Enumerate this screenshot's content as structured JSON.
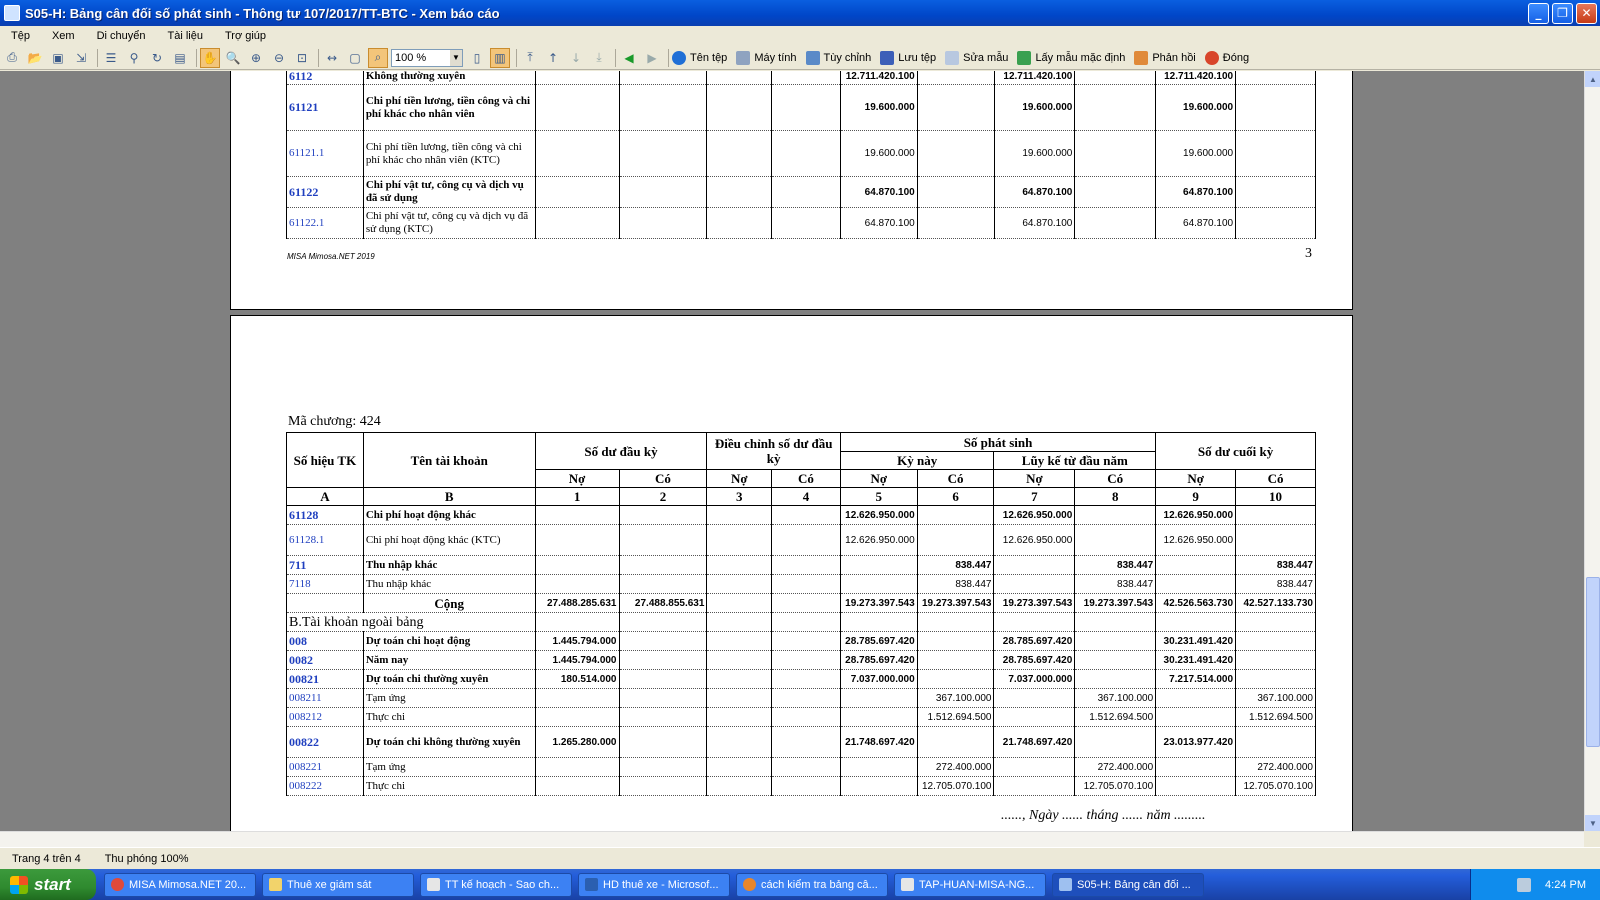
{
  "window": {
    "title": "S05-H: Bảng cân đối số phát sinh  - Thông tư 107/2017/TT-BTC - Xem báo cáo",
    "minimize": "_",
    "restore": "❐",
    "close": "✕"
  },
  "menu": [
    "Tệp",
    "Xem",
    "Di chuyển",
    "Tài liệu",
    "Trợ giúp"
  ],
  "toolbar": {
    "zoom": "100 %",
    "buttons": [
      "Tên tệp",
      "Máy tính",
      "Tùy chỉnh",
      "Lưu tệp",
      "Sửa mẫu",
      "Lấy mẫu mặc định",
      "Phản hồi",
      "Đóng"
    ]
  },
  "page3": {
    "rows": [
      {
        "code": "6112",
        "name": "Không thường xuyên",
        "bold": true,
        "c5": "12.711.420.100",
        "c7": "12.711.420.100",
        "c9": "12.711.420.100"
      },
      {
        "code": "61121",
        "name": "Chi phí tiền lương, tiền công và chi phí khác cho nhân viên",
        "bold": true,
        "c5": "19.600.000",
        "c7": "19.600.000",
        "c9": "19.600.000"
      },
      {
        "code": "61121.1",
        "name": "Chi phí tiền lương, tiền công và chi phí khác cho nhân viên (KTC)",
        "bold": false,
        "c5": "19.600.000",
        "c7": "19.600.000",
        "c9": "19.600.000"
      },
      {
        "code": "61122",
        "name": "Chi phí vật tư, công cụ và dịch vụ đã sử dụng",
        "bold": true,
        "c5": "64.870.100",
        "c7": "64.870.100",
        "c9": "64.870.100"
      },
      {
        "code": "61122.1",
        "name": "Chi phí vật tư, công cụ và dịch vụ đã sử dụng (KTC)",
        "bold": false,
        "c5": "64.870.100",
        "c7": "64.870.100",
        "c9": "64.870.100"
      }
    ],
    "footer_left": "MISA Mimosa.NET 2019",
    "page_number": "3"
  },
  "page4": {
    "chapter": "Mã chương: 424",
    "headers": {
      "code": "Số hiệu TK",
      "name": "Tên tài khoản",
      "opening": "Số dư đầu kỳ",
      "adjust": "Điều chỉnh số dư đầu kỳ",
      "arising": "Số phát sinh",
      "this_period": "Kỳ này",
      "ytd": "Lũy kế từ đầu năm",
      "closing": "Số dư cuối kỳ",
      "debit": "Nợ",
      "credit": "Có",
      "letters": [
        "A",
        "B",
        "1",
        "2",
        "3",
        "4",
        "5",
        "6",
        "7",
        "8",
        "9",
        "10"
      ]
    },
    "rows": [
      {
        "code": "61128",
        "name": "Chi phí hoạt động khác",
        "bold": true,
        "c5": "12.626.950.000",
        "c7": "12.626.950.000",
        "c9": "12.626.950.000"
      },
      {
        "code": "61128.1",
        "name": "Chi phí hoạt động khác (KTC)",
        "bold": false,
        "c5": "12.626.950.000",
        "c7": "12.626.950.000",
        "c9": "12.626.950.000"
      },
      {
        "code": "711",
        "name": "Thu nhập khác",
        "bold": true,
        "c6": "838.447",
        "c8": "838.447",
        "c10": "838.447"
      },
      {
        "code": "7118",
        "name": "Thu nhập khác",
        "bold": false,
        "c6": "838.447",
        "c8": "838.447",
        "c10": "838.447"
      }
    ],
    "total": {
      "label": "Cộng",
      "c1": "27.488.285.631",
      "c2": "27.488.855.631",
      "c5": "19.273.397.543",
      "c6": "19.273.397.543",
      "c7": "19.273.397.543",
      "c8": "19.273.397.543",
      "c9": "42.526.563.730",
      "c10": "42.527.133.730"
    },
    "section_b": "B.Tài khoản ngoài bảng",
    "rows_b": [
      {
        "code": "008",
        "name": "Dự toán chi hoạt động",
        "bold": true,
        "c1": "1.445.794.000",
        "c5": "28.785.697.420",
        "c7": "28.785.697.420",
        "c9": "30.231.491.420"
      },
      {
        "code": "0082",
        "name": "Năm nay",
        "bold": true,
        "c1": "1.445.794.000",
        "c5": "28.785.697.420",
        "c7": "28.785.697.420",
        "c9": "30.231.491.420"
      },
      {
        "code": "00821",
        "name": "Dự toán chi thường xuyên",
        "bold": true,
        "c1": "180.514.000",
        "c5": "7.037.000.000",
        "c7": "7.037.000.000",
        "c9": "7.217.514.000"
      },
      {
        "code": "008211",
        "name": "Tạm ứng",
        "bold": false,
        "c6": "367.100.000",
        "c8": "367.100.000",
        "c10": "367.100.000"
      },
      {
        "code": "008212",
        "name": "Thực chi",
        "bold": false,
        "c6": "1.512.694.500",
        "c8": "1.512.694.500",
        "c10": "1.512.694.500"
      },
      {
        "code": "00822",
        "name": "Dự toán chi không thường xuyên",
        "bold": true,
        "c1": "1.265.280.000",
        "c5": "21.748.697.420",
        "c7": "21.748.697.420",
        "c9": "23.013.977.420"
      },
      {
        "code": "008221",
        "name": "Tạm ứng",
        "bold": false,
        "c6": "272.400.000",
        "c8": "272.400.000",
        "c10": "272.400.000"
      },
      {
        "code": "008222",
        "name": "Thực chi",
        "bold": false,
        "c6": "12.705.070.100",
        "c8": "12.705.070.100",
        "c10": "12.705.070.100"
      }
    ],
    "date_line": "......, Ngày ...... tháng ...... năm ........."
  },
  "status": {
    "page": "Trang 4 trên 4",
    "zoom": "Thu phóng 100%"
  },
  "taskbar": {
    "start": "start",
    "tasks": [
      "MISA Mimosa.NET 20...",
      "Thuê xe giám sát",
      "TT kế hoạch - Sao ch...",
      "HD thuê xe - Microsof...",
      "cách kiểm tra bảng câ...",
      "TAP-HUAN-MISA-NG...",
      "S05-H: Bảng cân đối ..."
    ],
    "clock": "4:24 PM"
  }
}
